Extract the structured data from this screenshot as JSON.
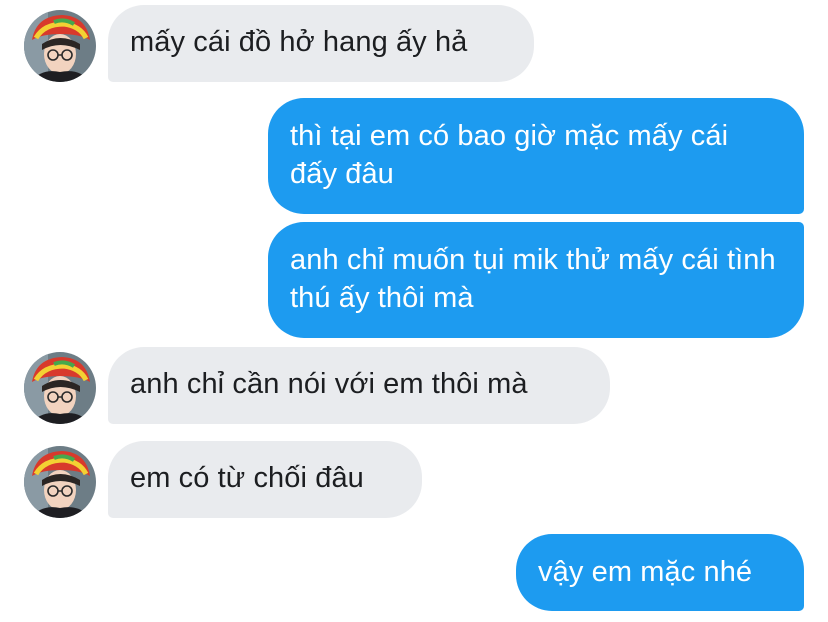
{
  "messages": [
    {
      "direction": "incoming",
      "text": "mấy cái đồ hở hang ấy hả"
    },
    {
      "direction": "outgoing",
      "text": "thì tại em có bao giờ mặc mấy cái đấy đâu"
    },
    {
      "direction": "outgoing",
      "text": "anh chỉ muốn tụi mik thử mấy cái tình thú ấy thôi mà"
    },
    {
      "direction": "incoming",
      "text": "anh chỉ cần nói với em thôi mà"
    },
    {
      "direction": "incoming",
      "text": "em có từ chối đâu"
    },
    {
      "direction": "outgoing",
      "text": "vậy em mặc nhé"
    }
  ],
  "colors": {
    "incoming_bubble": "#e9ebee",
    "incoming_text": "#1c1e21",
    "outgoing_bubble": "#1d9bf0",
    "outgoing_text": "#ffffff"
  },
  "avatar_icon": "user-avatar-icon"
}
